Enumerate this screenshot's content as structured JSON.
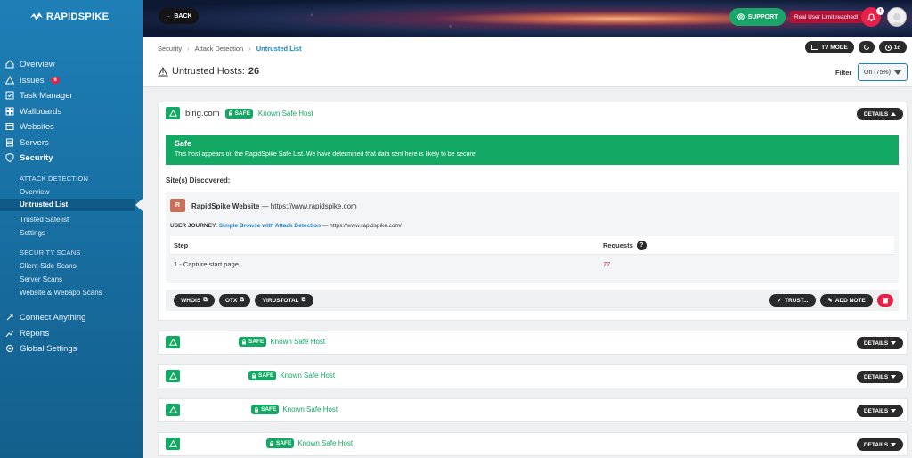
{
  "app": {
    "name": "RAPIDSPIKE"
  },
  "sidebar": {
    "items": [
      {
        "label": "Overview",
        "icon": "home-icon"
      },
      {
        "label": "Issues",
        "icon": "warning-icon",
        "badge": "6"
      },
      {
        "label": "Task Manager",
        "icon": "checklist-icon"
      },
      {
        "label": "Wallboards",
        "icon": "grid-icon"
      },
      {
        "label": "Websites",
        "icon": "globe-icon"
      },
      {
        "label": "Servers",
        "icon": "server-icon"
      },
      {
        "label": "Security",
        "icon": "shield-icon"
      },
      {
        "label": "Connect Anything",
        "icon": "rocket-icon"
      },
      {
        "label": "Reports",
        "icon": "chart-icon"
      },
      {
        "label": "Global Settings",
        "icon": "gear-icon"
      }
    ],
    "attack_detection": {
      "header": "ATTACK DETECTION",
      "items": [
        "Overview",
        "Untrusted List",
        "Trusted Safelist",
        "Settings"
      ]
    },
    "security_scans": {
      "header": "SECURITY SCANS",
      "items": [
        "Client-Side Scans",
        "Server Scans",
        "Website & Webapp Scans"
      ]
    }
  },
  "topbar": {
    "back_label": "BACK",
    "support_label": "SUPPORT",
    "limit_text": "Real User Limit reached!",
    "notification_count": "1"
  },
  "breadcrumb": [
    "Security",
    "Attack Detection",
    "Untrusted List"
  ],
  "header_buttons": {
    "tv_mode": "TV MODE",
    "range": "1d"
  },
  "title": {
    "label": "Untrusted Hosts:",
    "count": "26"
  },
  "filter": {
    "label": "Filter",
    "value": "On (75%)"
  },
  "expanded_host": {
    "name": "bing.com",
    "safe_badge": "SAFE",
    "status": "Known Safe Host",
    "details_label": "DETAILS",
    "banner_title": "Safe",
    "banner_text": "This host appears on the RapidSpike Safe List. We have determined that data sent here is likely to be secure.",
    "sites_label": "Site(s) Discovered:",
    "site": {
      "initial": "R",
      "name": "RapidSpike Website",
      "url": "— https://www.rapidspike.com",
      "journey_label": "USER JOURNEY:",
      "journey_name": "Simple Browse with Attack Detection",
      "journey_url": "— https://www.rapidspike.com/"
    },
    "table": {
      "headers": [
        "Step",
        "Requests"
      ],
      "rows": [
        {
          "step": "1 - Capture start page",
          "requests": "77"
        }
      ]
    },
    "actions": {
      "whois": "WHOIS",
      "otx": "OTX",
      "virustotal": "VIRUSTOTAL",
      "trust": "TRUST...",
      "add_note": "ADD NOTE"
    }
  },
  "collapsed_hosts": [
    {
      "safe_badge": "SAFE",
      "status": "Known Safe Host",
      "details_label": "DETAILS"
    },
    {
      "safe_badge": "SAFE",
      "status": "Known Safe Host",
      "details_label": "DETAILS"
    },
    {
      "safe_badge": "SAFE",
      "status": "Known Safe Host",
      "details_label": "DETAILS"
    },
    {
      "safe_badge": "SAFE",
      "status": "Known Safe Host",
      "details_label": "DETAILS"
    }
  ],
  "colors": {
    "sidebar": "#1870a3",
    "safe_green": "#14a865",
    "alert_red": "#e5214a",
    "link_blue": "#1a84c2"
  }
}
